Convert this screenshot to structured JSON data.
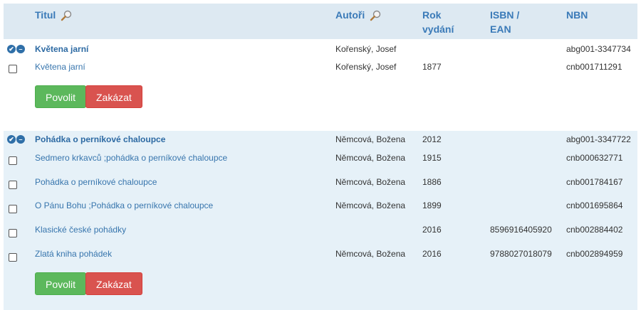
{
  "header": {
    "title": "Titul",
    "authors": "Autoři",
    "year_l1": "Rok",
    "year_l2": "vydání",
    "isbn_l1": "ISBN /",
    "isbn_l2": "EAN",
    "nbn": "NBN"
  },
  "groups": [
    {
      "main": {
        "title": "Květena jarní",
        "author": "Kořenský, Josef",
        "year": "",
        "isbn": "",
        "nbn": "abg001-3347734"
      },
      "rows": [
        {
          "title": "Květena jarní",
          "author": "Kořenský, Josef",
          "year": "1877",
          "isbn": "",
          "nbn": "cnb001711291"
        }
      ],
      "allow_label": "Povolit",
      "deny_label": "Zakázat"
    },
    {
      "main": {
        "title": "Pohádka o perníkové chaloupce",
        "author": "Němcová, Božena",
        "year": "2012",
        "isbn": "",
        "nbn": "abg001-3347722"
      },
      "rows": [
        {
          "title": "Sedmero krkavců ;pohádka o perníkové chaloupce",
          "author": "Němcová, Božena",
          "year": "1915",
          "isbn": "",
          "nbn": "cnb000632771"
        },
        {
          "title": "Pohádka o perníkové chaloupce",
          "author": "Němcová, Božena",
          "year": "1886",
          "isbn": "",
          "nbn": "cnb001784167"
        },
        {
          "title": "O Pánu Bohu ;Pohádka o perníkové chaloupce",
          "author": "Němcová, Božena",
          "year": "1899",
          "isbn": "",
          "nbn": "cnb001695864"
        },
        {
          "title": "Klasické české pohádky",
          "author": "",
          "year": "2016",
          "isbn": "8596916405920",
          "nbn": "cnb002884402"
        },
        {
          "title": "Zlatá kniha pohádek",
          "author": "Němcová, Božena",
          "year": "2016",
          "isbn": "9788027018079",
          "nbn": "cnb002894959"
        }
      ],
      "allow_label": "Povolit",
      "deny_label": "Zakázat"
    }
  ],
  "icons": {
    "select_all": "check-circle-icon",
    "deselect_all": "minus-circle-icon",
    "search": "magnifier-icon"
  }
}
